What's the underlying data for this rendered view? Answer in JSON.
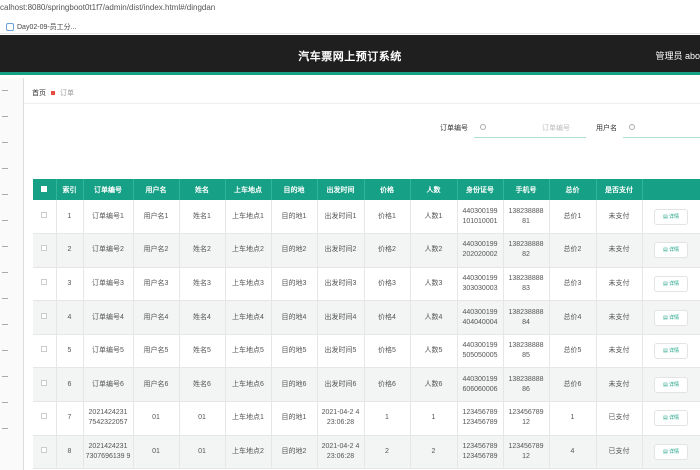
{
  "browser": {
    "url": "calhost:8080/springboot0t1f7/admin/dist/index.html#/dingdan",
    "tab_label": "Day02-09-员工分..."
  },
  "header": {
    "title": "汽车票网上预订系统",
    "user": "管理员 abo"
  },
  "breadcrumb": {
    "home": "首页",
    "current": "订单"
  },
  "search": {
    "order_label": "订单编号",
    "order_placeholder": "订单编号",
    "user_label": "用户名"
  },
  "table": {
    "columns": [
      "索引",
      "订单编号",
      "用户名",
      "姓名",
      "上车地点",
      "目的地",
      "出发时间",
      "价格",
      "人数",
      "身份证号",
      "手机号",
      "总价",
      "是否支付"
    ],
    "detail_label": "详情",
    "rows": [
      [
        "1",
        "订单编号1",
        "用户名1",
        "姓名1",
        "上车地点1",
        "目的地1",
        "出发时间1",
        "价格1",
        "人数1",
        "440300199 101010001",
        "138238888 81",
        "总价1",
        "未支付"
      ],
      [
        "2",
        "订单编号2",
        "用户名2",
        "姓名2",
        "上车地点2",
        "目的地2",
        "出发时间2",
        "价格2",
        "人数2",
        "440300199 202020002",
        "138238888 82",
        "总价2",
        "未支付"
      ],
      [
        "3",
        "订单编号3",
        "用户名3",
        "姓名3",
        "上车地点3",
        "目的地3",
        "出发时间3",
        "价格3",
        "人数3",
        "440300199 303030003",
        "138238888 83",
        "总价3",
        "未支付"
      ],
      [
        "4",
        "订单编号4",
        "用户名4",
        "姓名4",
        "上车地点4",
        "目的地4",
        "出发时间4",
        "价格4",
        "人数4",
        "440300199 404040004",
        "138238888 84",
        "总价4",
        "未支付"
      ],
      [
        "5",
        "订单编号5",
        "用户名5",
        "姓名5",
        "上车地点5",
        "目的地5",
        "出发时间5",
        "价格5",
        "人数5",
        "440300199 505050005",
        "138238888 85",
        "总价5",
        "未支付"
      ],
      [
        "6",
        "订单编号6",
        "用户名6",
        "姓名6",
        "上车地点6",
        "目的地6",
        "出发时间6",
        "价格6",
        "人数6",
        "440300199 606060006",
        "138238888 86",
        "总价6",
        "未支付"
      ],
      [
        "7",
        "2021424231 7542322057",
        "01",
        "01",
        "上车地点1",
        "目的地1",
        "2021-04-2 4 23:06:28",
        "1",
        "1",
        "123456789 123456789",
        "123456789 12",
        "1",
        "已支付"
      ],
      [
        "8",
        "2021424231 7307696139 9",
        "01",
        "01",
        "上车地点2",
        "目的地2",
        "2021-04-2 4 23:06:28",
        "2",
        "2",
        "123456789 123456789",
        "123456789 12",
        "4",
        "已支付"
      ]
    ]
  }
}
